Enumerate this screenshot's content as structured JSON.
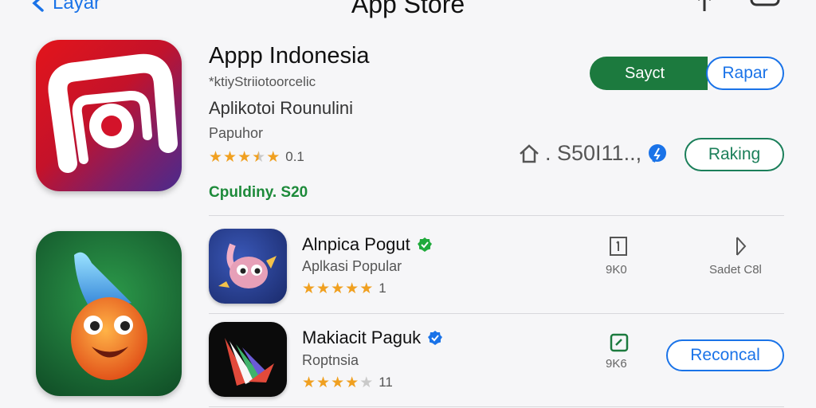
{
  "nav": {
    "back_label": "Layar",
    "title": "App Store"
  },
  "hero": {
    "name": "Appp Indonesia",
    "subtitle": "*ktiyStriiotoorcelic",
    "category": "Aplikotoi Rounulini",
    "developer": "Papuhor",
    "rating": 3.5,
    "rating_count": "0.1",
    "price": "Cpuldiny. S20",
    "get_label": "Sayct",
    "open_label": "Rapar",
    "meta_text": ". S50I11..,",
    "rank_label": "Raking"
  },
  "apps": [
    {
      "name": "Alnpica Pogut",
      "subtitle": "Aplkasi Popular",
      "rating": 5,
      "rating_count": "1",
      "stat1_value": "9K0",
      "stat2_value": "Sadet C8l",
      "verified_color": "#1faa3b"
    },
    {
      "name": "Makiacit Paguk",
      "subtitle": "Roptnsia",
      "rating": 4,
      "rating_count": "11",
      "stat1_value": "9K6",
      "action_label": "Reconcal",
      "verified_color": "#1a73e8"
    }
  ],
  "colors": {
    "accent": "#1a73e8",
    "get_button": "#1c7a3e",
    "price": "#1d8a3a",
    "star": "#f0a020"
  }
}
